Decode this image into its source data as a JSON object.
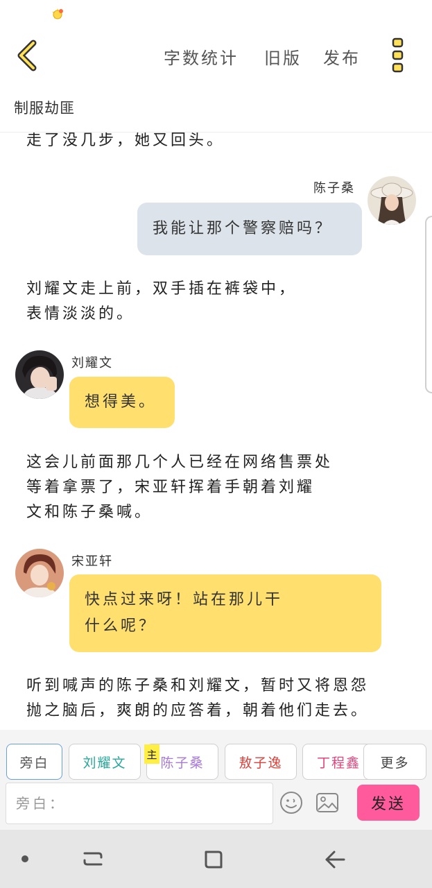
{
  "toolbar": {
    "word_count": "字数统计",
    "old_version": "旧版",
    "publish": "发布"
  },
  "document": {
    "title": "制服劫匪"
  },
  "story": {
    "narration_1": "走了没几步，她又回头。",
    "msg_1": {
      "speaker": "陈子桑",
      "text": "我能让那个警察赔吗？"
    },
    "narration_2_line_1": "刘耀文走上前，双手插在裤袋中，",
    "narration_2_line_2": "表情淡淡的。",
    "msg_2": {
      "speaker": "刘耀文",
      "text": "想得美。"
    },
    "narration_3_line_1": "这会儿前面那几个人已经在网络售票处",
    "narration_3_line_2": "等着拿票了，宋亚轩挥着手朝着刘耀",
    "narration_3_line_3": "文和陈子桑喊。",
    "msg_3": {
      "speaker": "宋亚轩",
      "line_1": "快点过来呀！站在那儿干",
      "line_2": "什么呢？"
    },
    "narration_4_line_1": "听到喊声的陈子桑和刘耀文，暂时又将恩怨",
    "narration_4_line_2": "抛之脑后，爽朗的应答着，朝着他们走去。"
  },
  "roles": {
    "narrator": "旁白",
    "liu_yaowen": "刘耀文",
    "chen_zisang": "陈子桑",
    "main_tag": "主",
    "ao_zi_yi": "敖子逸",
    "ding_chengxin": "丁程鑫",
    "more": "更多"
  },
  "composer": {
    "placeholder": "旁白：",
    "send_label": "发送"
  },
  "colors": {
    "accent_yellow": "#ffdf6e",
    "send_pink": "#ff5a9c",
    "bubble_grey": "#dde3ea",
    "role_liu": "#2aa79b",
    "role_chen": "#a77ad8",
    "role_ao": "#d9413a",
    "role_ding": "#e0457b"
  }
}
